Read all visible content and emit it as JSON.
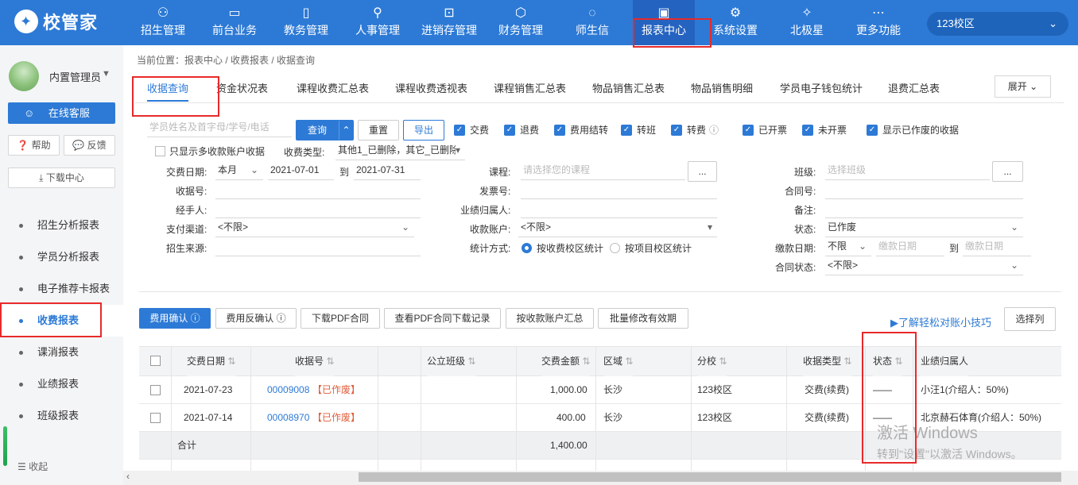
{
  "app": {
    "logo_text": "校管家"
  },
  "nav": [
    {
      "label": "招生管理",
      "icon": "person-add-icon"
    },
    {
      "label": "前台业务",
      "icon": "monitor-icon"
    },
    {
      "label": "教务管理",
      "icon": "book-icon"
    },
    {
      "label": "人事管理",
      "icon": "person-icon"
    },
    {
      "label": "进销存管理",
      "icon": "arrow-box-icon"
    },
    {
      "label": "财务管理",
      "icon": "wallet-icon"
    },
    {
      "label": "师生信",
      "icon": "chat-icon"
    },
    {
      "label": "报表中心",
      "icon": "chart-icon"
    },
    {
      "label": "系统设置",
      "icon": "gear-icon"
    },
    {
      "label": "北极星",
      "icon": "star-icon"
    },
    {
      "label": "更多功能",
      "icon": "more-icon"
    }
  ],
  "campus": {
    "label": "123校区"
  },
  "sidebar": {
    "user": "内置管理员",
    "service": "在线客服",
    "help": "帮助",
    "feedback": "反馈",
    "download": "下载中心",
    "items": [
      "招生分析报表",
      "学员分析报表",
      "电子推荐卡报表",
      "收费报表",
      "课消报表",
      "业绩报表",
      "班级报表"
    ],
    "collapse": "收起"
  },
  "breadcrumb": "当前位置：报表中心 / 收费报表 / 收据查询",
  "tabs": [
    "收据查询",
    "资金状况表",
    "课程收费汇总表",
    "课程收费透视表",
    "课程销售汇总表",
    "物品销售汇总表",
    "物品销售明细",
    "学员电子钱包统计",
    "退费汇总表"
  ],
  "expand": "展开",
  "search": {
    "placeholder": "学员姓名及首字母/学号/电话",
    "query": "查询",
    "reset": "重置",
    "export": "导出"
  },
  "checks": [
    "交费",
    "退费",
    "费用结转",
    "转班",
    "转费",
    "已开票",
    "未开票",
    "显示已作废的收据"
  ],
  "multi_account": "只显示多收款账户收据",
  "filters": {
    "receipt_type_label": "收费类型:",
    "receipt_type_value": "其他1_已删除，其它_已删除",
    "date_label": "交费日期:",
    "date_range": "本月",
    "date_from": "2021-07-01",
    "date_to_label": "到",
    "date_to": "2021-07-31",
    "receipt_no_label": "收据号:",
    "handler_label": "经手人:",
    "pay_channel_label": "支付渠道:",
    "pay_channel_value": "<不限>",
    "source_label": "招生来源:",
    "course_label": "课程:",
    "course_placeholder": "请选择您的课程",
    "invoice_label": "发票号:",
    "perf_label": "业绩归属人:",
    "account_label": "收款账户:",
    "account_value": "<不限>",
    "stat_label": "统计方式:",
    "stat_opt1": "按收费校区统计",
    "stat_opt2": "按项目校区统计",
    "class_label": "班级:",
    "class_placeholder": "选择班级",
    "contract_label": "合同号:",
    "remark_label": "备注:",
    "status_label": "状态:",
    "status_value": "已作废",
    "paydate_label": "缴款日期:",
    "paydate_range": "不限",
    "paydate_from_ph": "缴款日期",
    "paydate_to_label": "到",
    "paydate_to_ph": "缴款日期",
    "contract_status_label": "合同状态:",
    "contract_status_value": "<不限>",
    "more_btn": "..."
  },
  "actions": [
    "费用确认",
    "费用反确认",
    "下载PDF合同",
    "查看PDF合同下载记录",
    "按收款账户汇总",
    "批量修改有效期"
  ],
  "tips": "了解轻松对账小技巧",
  "choose_cols": "选择列",
  "table": {
    "headers": [
      "交费日期",
      "收据号",
      "公立班级",
      "交费金额",
      "区域",
      "分校",
      "收据类型",
      "状态",
      "业绩归属人"
    ],
    "rows": [
      {
        "date": "2021-07-23",
        "no": "00009008",
        "tag": "【已作废】",
        "amount": "1,000.00",
        "region": "长沙",
        "branch": "123校区",
        "type": "交费(续费)",
        "status": "——",
        "owner": "小汪1(介绍人：50%)"
      },
      {
        "date": "2021-07-14",
        "no": "00008970",
        "tag": "【已作废】",
        "amount": "400.00",
        "region": "长沙",
        "branch": "123校区",
        "type": "交费(续费)",
        "status": "——",
        "owner": "北京赫石体育(介绍人：50%)"
      }
    ],
    "sum_label": "合计",
    "sum_amount": "1,400.00"
  },
  "watermark": {
    "line1": "激活 Windows",
    "line2": "转到\"设置\"以激活 Windows。"
  },
  "colors": {
    "brand": "#2d7ad6",
    "highlight": "#e82a2a",
    "void": "#e05d3a"
  }
}
